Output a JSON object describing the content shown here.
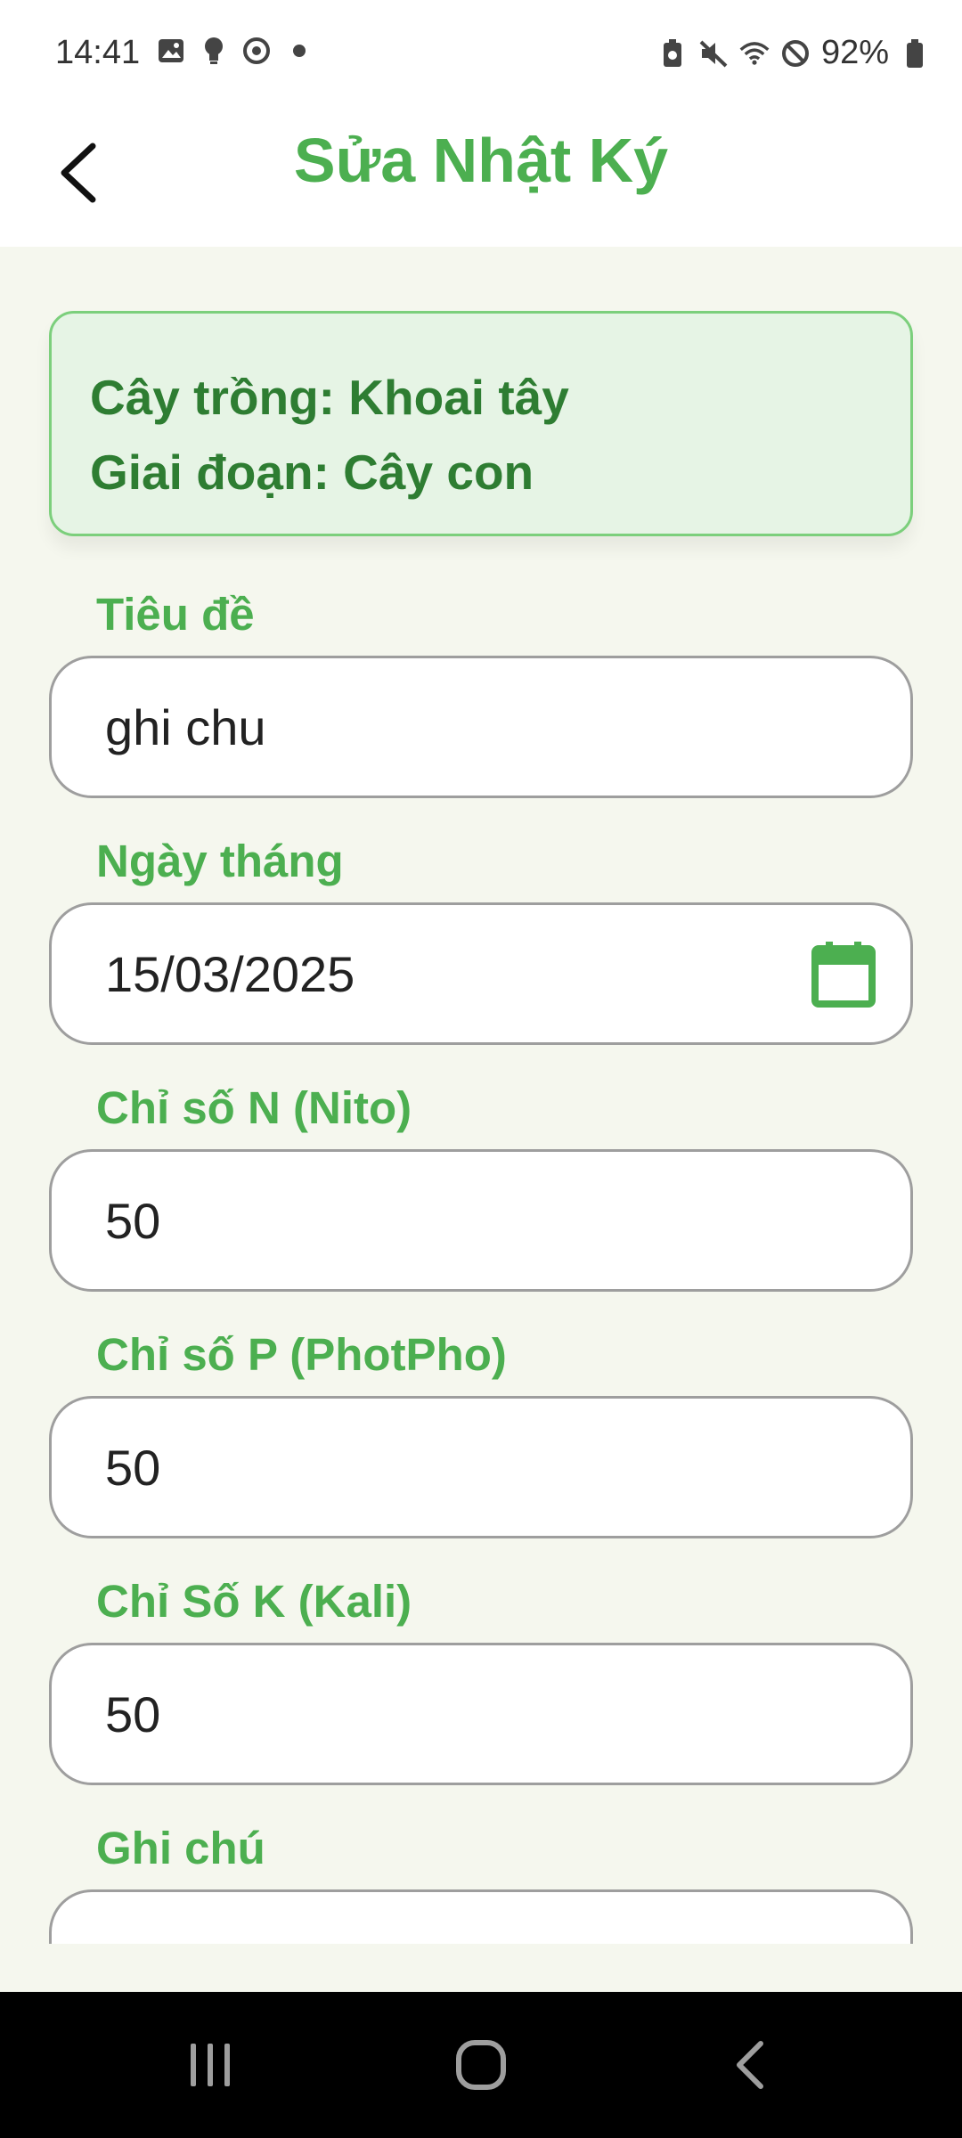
{
  "status_bar": {
    "time": "14:41",
    "battery_text": "92%",
    "left_icons": [
      "gallery-icon",
      "bulb-icon",
      "sync-icon",
      "dot-icon"
    ],
    "right_icons": [
      "battery-saver-icon",
      "mute-icon",
      "wifi-icon",
      "do-not-disturb-icon",
      "battery-icon"
    ]
  },
  "header": {
    "title": "Sửa Nhật Ký",
    "back_icon": "back-arrow-icon"
  },
  "info_card": {
    "crop_line": "Cây trồng: Khoai tây",
    "stage_line": "Giai đoạn: Cây con"
  },
  "form": {
    "title": {
      "label": "Tiêu đề",
      "value": "ghi chu"
    },
    "date": {
      "label": "Ngày tháng",
      "value": "15/03/2025",
      "icon": "calendar-icon"
    },
    "nitrogen": {
      "label": "Chỉ số N (Nito)",
      "value": "50"
    },
    "phosphorus": {
      "label": "Chỉ số P (PhotPho)",
      "value": "50"
    },
    "potassium": {
      "label": "Chỉ Số K (Kali)",
      "value": "50"
    },
    "note": {
      "label": "Ghi chú"
    }
  },
  "nav_bar": {
    "icons": [
      "recent-apps-icon",
      "home-icon",
      "back-icon"
    ]
  },
  "colors": {
    "accent": "#4caf50",
    "accent_dark": "#2e7d32",
    "card_bg": "#e6f4e5",
    "page_bg": "#f5f7ee"
  }
}
